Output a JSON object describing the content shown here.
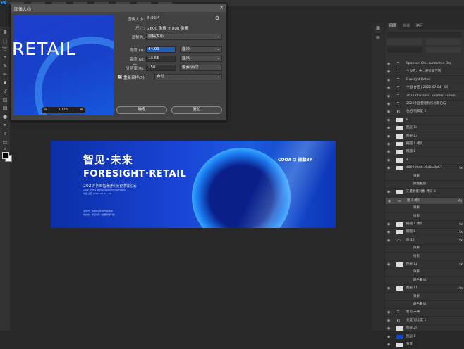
{
  "app": {
    "logo_text": "Ps"
  },
  "dialog": {
    "title": "图像大小",
    "close_glyph": "✕",
    "image_size_label": "图像大小:",
    "image_size_value": "5.95M",
    "dimensions_label": "尺寸:",
    "dimensions_value": "2600 像素 × 800 像素",
    "fit_label": "调整为:",
    "fit_value": "原稿大小",
    "width_label": "宽度(D):",
    "width_value": "44.03",
    "width_unit": "厘米",
    "height_label": "高度(G):",
    "height_value": "13.55",
    "height_unit": "厘米",
    "resolution_label": "分辨率(R):",
    "resolution_value": "150",
    "resolution_unit": "像素/英寸",
    "resample_label": "重新采样(S):",
    "resample_value": "自动",
    "resample_checked": true,
    "ok_label": "确定",
    "cancel_label": "复位",
    "preview_text": "RETAIL",
    "preview_zoom": "100%"
  },
  "document": {
    "cn_title": "智见·未来",
    "en_title": "FORESIGHT·RETAIL",
    "subtitle": "2022中国智能科技创新论坛",
    "sub_en": "2022 CHINA RETAIL INNOVATION FORUM",
    "date_line": "中国·合肥 | 2022.07.04 - 06",
    "org_line1": "主办方：中国智能科技创新联盟",
    "org_line2": "协办方：智见零售 / 合肥智能科技",
    "logos_text": "COOA  ⊟ 德勤BP"
  },
  "layers_panel": {
    "tabs": [
      "图层",
      "通道",
      "路径"
    ],
    "layers": [
      {
        "name": "Sponsor: Chi...ommittee Org",
        "type": "text"
      },
      {
        "name": "主办方：中...惠智能学院",
        "type": "text"
      },
      {
        "name": "F    resight Retail",
        "type": "text"
      },
      {
        "name": "中国·合肥 | 2022.07.04 - 06",
        "type": "text"
      },
      {
        "name": "2022 China Re...ovation Forum",
        "type": "text"
      },
      {
        "name": "2022中国智能科技创新论坛",
        "type": "text"
      },
      {
        "name": "色相/饱和度 1",
        "type": "adjust"
      },
      {
        "name": "8",
        "type": "pixel"
      },
      {
        "name": "图层 14",
        "type": "pixel"
      },
      {
        "name": "图层 13",
        "type": "pixel"
      },
      {
        "name": "椭圆 1 拷贝",
        "type": "shape"
      },
      {
        "name": "椭圆 1",
        "type": "shape"
      },
      {
        "name": "4",
        "type": "pixel"
      },
      {
        "name": "4809b0e4...6c6a4fc57",
        "type": "pixel",
        "fx": "fx"
      },
      {
        "name": "效果",
        "type": "effect"
      },
      {
        "name": "颜色叠加",
        "type": "effect"
      },
      {
        "name": "矢量智能对象 拷贝 8",
        "type": "pixel"
      },
      {
        "name": "图 3 拷贝",
        "type": "group",
        "fx": "fx",
        "selected": true
      },
      {
        "name": "效果",
        "type": "effect"
      },
      {
        "name": "投影",
        "type": "effect"
      },
      {
        "name": "椭圆 1 拷贝",
        "type": "shape",
        "fx": "fx"
      },
      {
        "name": "椭圆 1",
        "type": "shape",
        "fx": "fx"
      },
      {
        "name": "图 16",
        "type": "group",
        "fx": "fx"
      },
      {
        "name": "效果",
        "type": "effect"
      },
      {
        "name": "投影",
        "type": "effect"
      },
      {
        "name": "图层 12",
        "type": "pixel",
        "fx": "fx"
      },
      {
        "name": "效果",
        "type": "effect"
      },
      {
        "name": "颜色叠加",
        "type": "effect"
      },
      {
        "name": "图层 11",
        "type": "pixel",
        "fx": "fx"
      },
      {
        "name": "效果",
        "type": "effect"
      },
      {
        "name": "颜色叠加",
        "type": "effect"
      },
      {
        "name": "智见·未来",
        "type": "text"
      },
      {
        "name": "亮度/对比度 1",
        "type": "adjust"
      },
      {
        "name": "图层 29",
        "type": "pixel"
      },
      {
        "name": "图层 1",
        "type": "pixel",
        "blue": true
      },
      {
        "name": "背景",
        "type": "pixel"
      }
    ]
  }
}
